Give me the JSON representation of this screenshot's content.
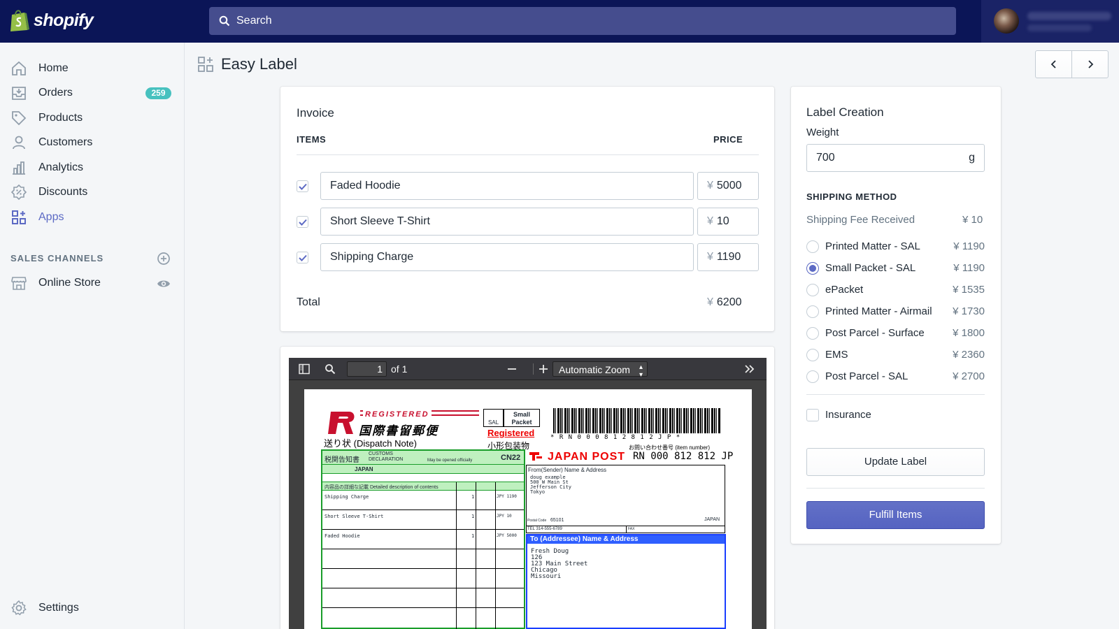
{
  "topbar": {
    "brand": "shopify",
    "search_placeholder": "Search"
  },
  "sidebar": {
    "items": [
      {
        "label": "Home",
        "icon": "home-icon"
      },
      {
        "label": "Orders",
        "icon": "orders-icon",
        "badge": "259"
      },
      {
        "label": "Products",
        "icon": "tag-icon"
      },
      {
        "label": "Customers",
        "icon": "person-icon"
      },
      {
        "label": "Analytics",
        "icon": "bar-chart-icon"
      },
      {
        "label": "Discounts",
        "icon": "discount-icon"
      },
      {
        "label": "Apps",
        "icon": "apps-icon",
        "active": true
      }
    ],
    "sales_channels_title": "SALES CHANNELS",
    "online_store": "Online Store",
    "settings": "Settings"
  },
  "page": {
    "title": "Easy Label"
  },
  "invoice": {
    "title": "Invoice",
    "items_header": "ITEMS",
    "price_header": "PRICE",
    "currency": "¥",
    "rows": [
      {
        "name": "Faded Hoodie",
        "price": "5000",
        "checked": true
      },
      {
        "name": "Short Sleeve T-Shirt",
        "price": "10",
        "checked": true
      },
      {
        "name": "Shipping Charge",
        "price": "1190",
        "checked": true
      }
    ],
    "total_label": "Total",
    "total_value": "6200"
  },
  "pdf": {
    "page_number": "1",
    "page_count": "of 1",
    "zoom": "Automatic Zoom",
    "label": {
      "registered": "REGISTERED",
      "intl_registered_jp": "国際書留郵便",
      "dispatch_note": "送り状 (Dispatch Note)",
      "sal_box": "SAL",
      "small_packet": "Small Packet",
      "registered_red": "Registered",
      "small_packet_jp": "小形包装物",
      "barcode_text": "* R N 0 0 0 8 1 2 8 1 2 J P *",
      "inquiry": "お問い合わせ番号 (item number)",
      "tracking": "RN 000 812 812 JP",
      "japan_post": "JAPAN POST",
      "customs_jp": "税関告知書",
      "customs": "CUSTOMS DECLARATION",
      "may_be_opened": "May be opened officially",
      "cn22": "CN22",
      "origin": "JAPAN",
      "contents_header": "内容品の詳細な記載 Detailed description of contents",
      "lines": [
        {
          "desc": "Shipping Charge",
          "qty": "1",
          "value": "JPY 1190"
        },
        {
          "desc": "Short Sleeve T-Shirt",
          "qty": "1",
          "value": "JPY 10"
        },
        {
          "desc": "Faded Hoodie",
          "qty": "1",
          "value": "JPY 5000"
        }
      ],
      "from_title": "From(Sender) Name & Address",
      "from_lines": [
        "doug example",
        "500 W Main St",
        "Jefferson City",
        "Tokyo"
      ],
      "postal_code_label": "Postal Code",
      "postal_code": "65101",
      "from_country": "JAPAN",
      "tel": "TEL 314-555-6789",
      "fax": "FAX",
      "to_title": "To (Addressee)  Name & Address",
      "to_lines": [
        "Fresh Doug",
        "126",
        "123 Main Street",
        "Chicago",
        "Missouri"
      ]
    }
  },
  "label_creation": {
    "title": "Label Creation",
    "weight_label": "Weight",
    "weight_value": "700",
    "weight_unit": "g",
    "shipping_method_title": "SHIPPING METHOD",
    "fee_received_label": "Shipping Fee Received",
    "fee_received_value": "¥ 10",
    "options": [
      {
        "label": "Printed Matter - SAL",
        "price": "¥ 1190",
        "selected": false
      },
      {
        "label": "Small Packet - SAL",
        "price": "¥ 1190",
        "selected": true
      },
      {
        "label": "ePacket",
        "price": "¥ 1535",
        "selected": false
      },
      {
        "label": "Printed Matter - Airmail",
        "price": "¥ 1730",
        "selected": false
      },
      {
        "label": "Post Parcel - Surface",
        "price": "¥ 1800",
        "selected": false
      },
      {
        "label": "EMS",
        "price": "¥ 2360",
        "selected": false
      },
      {
        "label": "Post Parcel - SAL",
        "price": "¥ 2700",
        "selected": false
      }
    ],
    "insurance_label": "Insurance",
    "update_button": "Update Label",
    "fulfill_button": "Fulfill Items"
  },
  "colors": {
    "topbar": "#0b1557",
    "accent": "#5c6ac4",
    "badge": "#47c1bf"
  }
}
